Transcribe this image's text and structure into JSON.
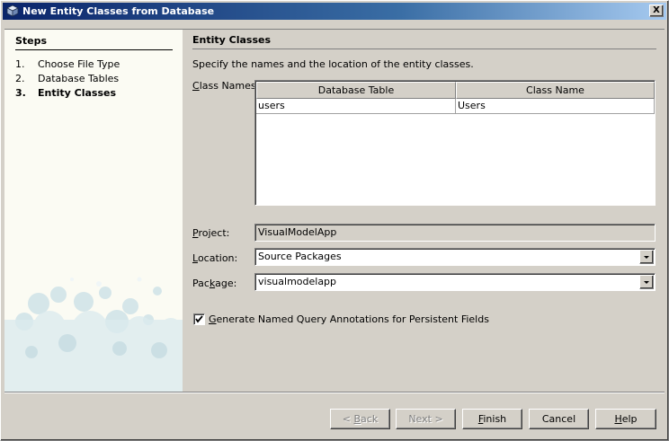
{
  "window": {
    "title": "New Entity Classes from Database",
    "close_label": "X"
  },
  "steps": {
    "heading": "Steps",
    "items": [
      {
        "num": "1.",
        "label": "Choose File Type"
      },
      {
        "num": "2.",
        "label": "Database Tables"
      },
      {
        "num": "3.",
        "label": "Entity Classes"
      }
    ]
  },
  "main": {
    "heading": "Entity Classes",
    "instructions": "Specify the names and the location of the entity classes.",
    "class_names": {
      "label_pre": "",
      "label_mn": "C",
      "label_post": "lass Names:",
      "columns": [
        "Database Table",
        "Class Name"
      ],
      "rows": [
        {
          "table": "users",
          "class_name": "Users"
        }
      ]
    },
    "project": {
      "label_pre": "",
      "label_mn": "P",
      "label_post": "roject:",
      "value": "VisualModelApp"
    },
    "location": {
      "label_pre": "",
      "label_mn": "L",
      "label_post": "ocation:",
      "value": "Source Packages"
    },
    "package": {
      "label_pre": "Pac",
      "label_mn": "k",
      "label_post": "age:",
      "value": "visualmodelapp"
    },
    "named_query": {
      "checked": true,
      "label_pre": "",
      "label_mn": "G",
      "label_post": "enerate Named Query Annotations for Persistent Fields"
    }
  },
  "buttons": {
    "back": {
      "pre": "< ",
      "mn": "B",
      "post": "ack"
    },
    "next": {
      "label": "Next >"
    },
    "finish": {
      "pre": "",
      "mn": "F",
      "post": "inish"
    },
    "cancel": {
      "label": "Cancel"
    },
    "help": {
      "pre": "",
      "mn": "H",
      "post": "elp"
    }
  }
}
